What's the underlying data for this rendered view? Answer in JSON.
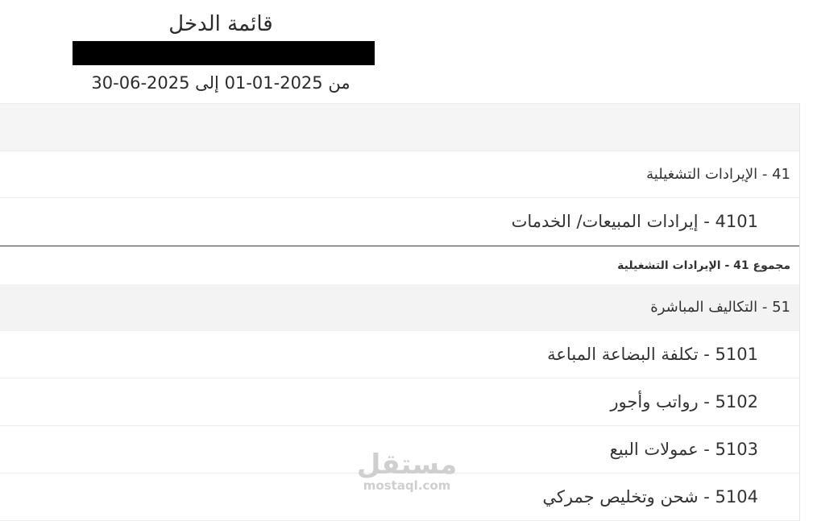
{
  "report": {
    "title": "قائمة الدخل",
    "period": "من 2025-01-01 إلى 2025-06-30"
  },
  "rows": {
    "g41": "41 - الإيرادات التشغيلية",
    "a4101": "4101 - إيرادات المبيعات/ الخدمات",
    "t41": "مجموع 41 - الإيرادات التشغيلية",
    "g51": "51 - التكاليف المباشرة",
    "a5101": "5101 - تكلفة البضاعة المباعة",
    "a5102": "5102 - رواتب وأجور",
    "a5103": "5103 - عمولات البيع",
    "a5104": "5104 - شحن وتخليص جمركي"
  },
  "watermark": {
    "arabic": "مستقل",
    "latin": "mostaql.com"
  }
}
